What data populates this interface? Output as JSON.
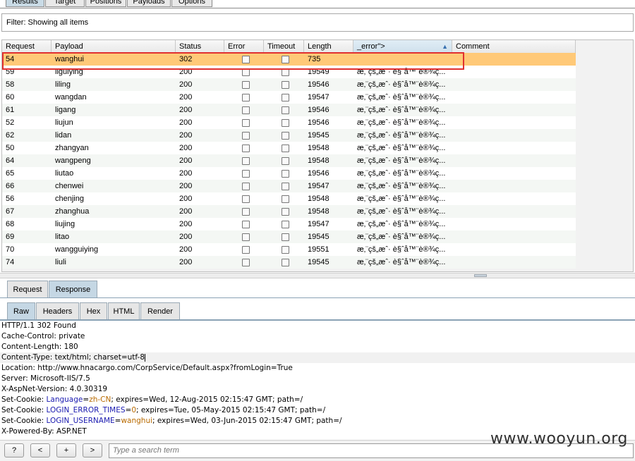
{
  "top_tabs": [
    "Results",
    "Target",
    "Positions",
    "Payloads",
    "Options"
  ],
  "filter": {
    "text": "Filter:  Showing all items"
  },
  "table": {
    "headers": [
      "Request",
      "Payload",
      "Status",
      "Error",
      "Timeout",
      "Length",
      "_error\">",
      "Comment"
    ],
    "rows": [
      {
        "request": "54",
        "payload": "wanghui",
        "status": "302",
        "length": "735",
        "error_col": ""
      },
      {
        "request": "59",
        "payload": "liguiying",
        "status": "200",
        "length": "19549",
        "error_col": "æ‚¨çš„æˆ· è§ˆå™¨è®¾ç..."
      },
      {
        "request": "58",
        "payload": "liling",
        "status": "200",
        "length": "19546",
        "error_col": "æ‚¨çš„æˆ· è§ˆå™¨è®¾ç..."
      },
      {
        "request": "60",
        "payload": "wangdan",
        "status": "200",
        "length": "19547",
        "error_col": "æ‚¨çš„æˆ· è§ˆå™¨è®¾ç..."
      },
      {
        "request": "61",
        "payload": "ligang",
        "status": "200",
        "length": "19546",
        "error_col": "æ‚¨çš„æˆ· è§ˆå™¨è®¾ç..."
      },
      {
        "request": "52",
        "payload": "liujun",
        "status": "200",
        "length": "19546",
        "error_col": "æ‚¨çš„æˆ· è§ˆå™¨è®¾ç..."
      },
      {
        "request": "62",
        "payload": "lidan",
        "status": "200",
        "length": "19545",
        "error_col": "æ‚¨çš„æˆ· è§ˆå™¨è®¾ç..."
      },
      {
        "request": "50",
        "payload": "zhangyan",
        "status": "200",
        "length": "19548",
        "error_col": "æ‚¨çš„æˆ· è§ˆå™¨è®¾ç..."
      },
      {
        "request": "64",
        "payload": "wangpeng",
        "status": "200",
        "length": "19548",
        "error_col": "æ‚¨çš„æˆ· è§ˆå™¨è®¾ç..."
      },
      {
        "request": "65",
        "payload": "liutao",
        "status": "200",
        "length": "19546",
        "error_col": "æ‚¨çš„æˆ· è§ˆå™¨è®¾ç..."
      },
      {
        "request": "66",
        "payload": "chenwei",
        "status": "200",
        "length": "19547",
        "error_col": "æ‚¨çš„æˆ· è§ˆå™¨è®¾ç..."
      },
      {
        "request": "56",
        "payload": "chenjing",
        "status": "200",
        "length": "19548",
        "error_col": "æ‚¨çš„æˆ· è§ˆå™¨è®¾ç..."
      },
      {
        "request": "67",
        "payload": "zhanghua",
        "status": "200",
        "length": "19548",
        "error_col": "æ‚¨çš„æˆ· è§ˆå™¨è®¾ç..."
      },
      {
        "request": "68",
        "payload": "liujing",
        "status": "200",
        "length": "19547",
        "error_col": "æ‚¨çš„æˆ· è§ˆå™¨è®¾ç..."
      },
      {
        "request": "69",
        "payload": "litao",
        "status": "200",
        "length": "19545",
        "error_col": "æ‚¨çš„æˆ· è§ˆå™¨è®¾ç..."
      },
      {
        "request": "70",
        "payload": "wangguiying",
        "status": "200",
        "length": "19551",
        "error_col": "æ‚¨çš„æˆ· è§ˆå™¨è®¾ç..."
      },
      {
        "request": "74",
        "payload": "liuli",
        "status": "200",
        "length": "19545",
        "error_col": "æ‚¨çš„æˆ· è§ˆå™¨è®¾ç..."
      }
    ]
  },
  "rr_tabs": [
    "Request",
    "Response"
  ],
  "view_tabs": [
    "Raw",
    "Headers",
    "Hex",
    "HTML",
    "Render"
  ],
  "response": {
    "l1": "HTTP/1.1 302 Found",
    "l2": "Cache-Control: private",
    "l3": "Content-Length: 180",
    "l4": "Content-Type: text/html; charset=utf-8",
    "l5": "Location: http://www.hnacargo.com/CorpService/Default.aspx?fromLogin=True",
    "l6": "Server: Microsoft-IIS/7.5",
    "l7": "X-AspNet-Version: 4.0.30319",
    "c1_pre": "Set-Cookie: ",
    "c1_key": "Language",
    "c1_eq": "=",
    "c1_val": "zh-CN",
    "c1_post": "; expires=Wed, 12-Aug-2015 02:15:47 GMT; path=/",
    "c2_pre": "Set-Cookie: ",
    "c2_key": "LOGIN_ERROR_TIMES",
    "c2_eq": "=",
    "c2_val": "0",
    "c2_post": "; expires=Tue, 05-May-2015 02:15:47 GMT; path=/",
    "c3_pre": "Set-Cookie: ",
    "c3_key": "LOGIN_USERNAME",
    "c3_eq": "=",
    "c3_val": "wanghui",
    "c3_post": "; expires=Wed, 03-Jun-2015 02:15:47 GMT; path=/",
    "l11": "X-Powered-By: ASP.NET"
  },
  "bottom": {
    "help": "?",
    "prev": "<",
    "add": "+",
    "next": ">",
    "search_placeholder": "Type a search term"
  },
  "watermark": "www.wooyun.org"
}
